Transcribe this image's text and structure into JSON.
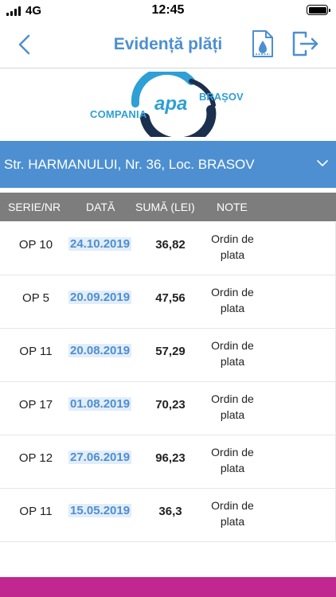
{
  "status_bar": {
    "carrier": "4G",
    "time": "12:45"
  },
  "nav": {
    "title": "Evidență plăți"
  },
  "logo": {
    "left": "COMPANIA",
    "center": "apa",
    "right": "BRAȘOV"
  },
  "address": {
    "selected": "Str. HARMANULUI, Nr. 36, Loc. BRASOV"
  },
  "table": {
    "headers": [
      "SERIE/NR",
      "DATĂ",
      "SUMĂ (LEI)",
      "NOTE"
    ],
    "rows": [
      {
        "serie": "OP 10",
        "date": "24.10.2019",
        "sum": "36,82",
        "note": "Ordin de plata"
      },
      {
        "serie": "OP 5",
        "date": "20.09.2019",
        "sum": "47,56",
        "note": "Ordin de plata"
      },
      {
        "serie": "OP 11",
        "date": "20.08.2019",
        "sum": "57,29",
        "note": "Ordin de plata"
      },
      {
        "serie": "OP 17",
        "date": "01.08.2019",
        "sum": "70,23",
        "note": "Ordin de plata"
      },
      {
        "serie": "OP 12",
        "date": "27.06.2019",
        "sum": "96,23",
        "note": "Ordin de plata"
      },
      {
        "serie": "OP 11",
        "date": "15.05.2019",
        "sum": "36,3",
        "note": "Ordin de plata"
      }
    ]
  },
  "icons": {
    "back": "chevron-left-icon",
    "document": "water-document-icon",
    "logout": "logout-icon",
    "dropdown": "chevron-down-icon"
  },
  "colors": {
    "accent": "#4d8fd1",
    "header_gray": "#7d7d7d",
    "logo_blue": "#2f9fd6",
    "logo_navy": "#1b2f4e",
    "bottom_bar": "#c0278f"
  }
}
